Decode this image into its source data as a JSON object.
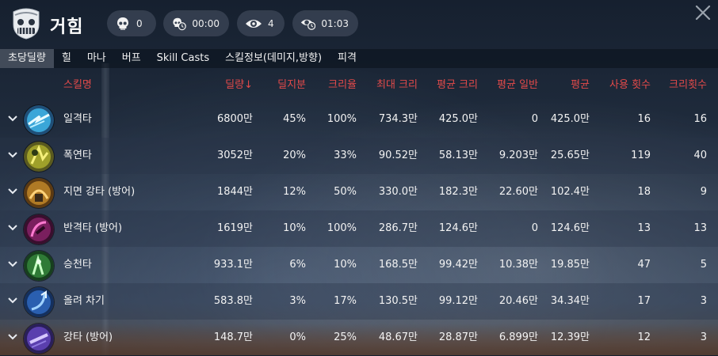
{
  "header": {
    "title": "거힘",
    "deaths": "0",
    "death_time": "00:00",
    "views": "4",
    "elapsed": "01:03"
  },
  "tabs": [
    "초당딜량",
    "힐",
    "마나",
    "버프",
    "Skill Casts",
    "스킬정보(데미지,방향)",
    "피격"
  ],
  "active_tab": 0,
  "columns": {
    "name": "스킬명",
    "damage": "딜량↓",
    "share": "딜지분",
    "crit_rate": "크리율",
    "max_crit": "최대 크리",
    "avg_crit": "평균 크리",
    "avg_normal": "평균 일반",
    "avg": "평균",
    "casts": "사용 횟수",
    "crits": "크리횟수"
  },
  "rows": [
    {
      "icon": "lightning-strike-icon",
      "name": "일격타",
      "damage": "6800만",
      "share": "45%",
      "crit_rate": "100%",
      "max_crit": "734.3만",
      "avg_crit": "425.0만",
      "avg_normal": "0",
      "avg": "425.0만",
      "casts": "16",
      "crits": "16"
    },
    {
      "icon": "explosion-strike-icon",
      "name": "폭연타",
      "damage": "3052만",
      "share": "20%",
      "crit_rate": "33%",
      "max_crit": "90.52만",
      "avg_crit": "58.13만",
      "avg_normal": "9.203만",
      "avg": "25.65만",
      "casts": "119",
      "crits": "40"
    },
    {
      "icon": "ground-smash-icon",
      "name": "지면 강타 (방어)",
      "damage": "1844만",
      "share": "12%",
      "crit_rate": "50%",
      "max_crit": "330.0만",
      "avg_crit": "182.3만",
      "avg_normal": "22.60만",
      "avg": "102.4만",
      "casts": "18",
      "crits": "9"
    },
    {
      "icon": "counter-strike-icon",
      "name": "반격타 (방어)",
      "damage": "1619만",
      "share": "10%",
      "crit_rate": "100%",
      "max_crit": "286.7만",
      "avg_crit": "124.6만",
      "avg_normal": "0",
      "avg": "124.6만",
      "casts": "13",
      "crits": "13"
    },
    {
      "icon": "rising-strike-icon",
      "name": "승천타",
      "damage": "933.1만",
      "share": "6%",
      "crit_rate": "10%",
      "max_crit": "168.5만",
      "avg_crit": "99.42만",
      "avg_normal": "10.38만",
      "avg": "19.85만",
      "casts": "47",
      "crits": "5"
    },
    {
      "icon": "uppercut-kick-icon",
      "name": "올려 차기",
      "damage": "583.8만",
      "share": "3%",
      "crit_rate": "17%",
      "max_crit": "130.5만",
      "avg_crit": "99.12만",
      "avg_normal": "20.46만",
      "avg": "34.34만",
      "casts": "17",
      "crits": "3"
    },
    {
      "icon": "heavy-strike-icon",
      "name": "강타 (방어)",
      "damage": "148.7만",
      "share": "0%",
      "crit_rate": "25%",
      "max_crit": "48.67만",
      "avg_crit": "28.87만",
      "avg_normal": "6.899만",
      "avg": "12.39만",
      "casts": "12",
      "crits": "3"
    }
  ],
  "colors": {
    "header_red": "#e34a4a",
    "pill_bg": "#364050",
    "tab_active": "#464e5c"
  }
}
